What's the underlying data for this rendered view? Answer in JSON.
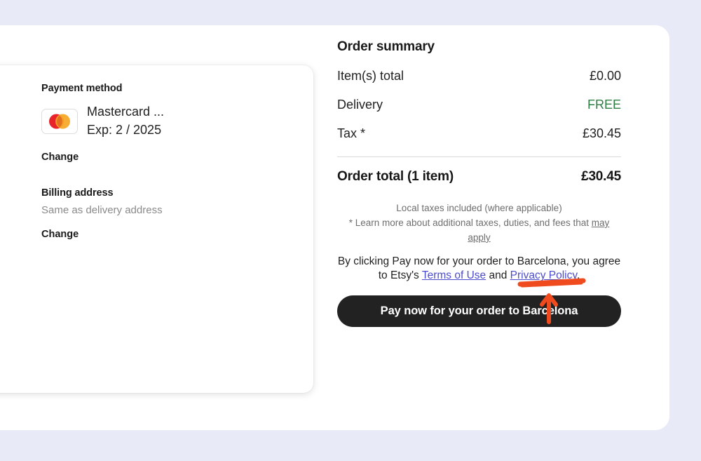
{
  "theme": {
    "page_background": "#e9eaf7",
    "panel_background": "#ffffff",
    "button_background": "#222222",
    "free_color": "#2e7d43",
    "link_color": "#4c4ccd",
    "annotation_color": "#ef4b1e",
    "mastercard_red": "#e8232a",
    "mastercard_yellow": "#f5a623"
  },
  "payment": {
    "section_title": "Payment method",
    "card_brand_icon": "mastercard-logo",
    "card_name": "Mastercard ...",
    "card_expiry": "Exp:  2 / 2025",
    "change_payment_label": "Change",
    "billing_title": "Billing address",
    "billing_value": "Same as delivery address",
    "change_billing_label": "Change"
  },
  "summary": {
    "title": "Order summary",
    "lines": [
      {
        "label": "Item(s) total",
        "value": "£0.00",
        "style": "normal"
      },
      {
        "label": "Delivery",
        "value": "FREE",
        "style": "free"
      },
      {
        "label": "Tax *",
        "value": "£30.45",
        "style": "normal"
      }
    ],
    "total": {
      "label": "Order total (1 item)",
      "value": "£30.45"
    },
    "fineprint_line1": "Local taxes included (where applicable)",
    "fineprint_line2_prefix": "* Learn more about additional taxes, duties, and fees that ",
    "fineprint_link": "may apply",
    "agree_prefix": "By clicking Pay now for your order to Barcelona, you agree to Etsy's ",
    "terms_link": "Terms of Use",
    "agree_middle": " and ",
    "privacy_link": "Privacy Policy",
    "agree_suffix": ".",
    "pay_button_label": "Pay now for your order to Barcelona"
  },
  "annotation": {
    "type": "arrow-and-underline",
    "target": "pay-now-button",
    "color": "#ef4b1e"
  }
}
